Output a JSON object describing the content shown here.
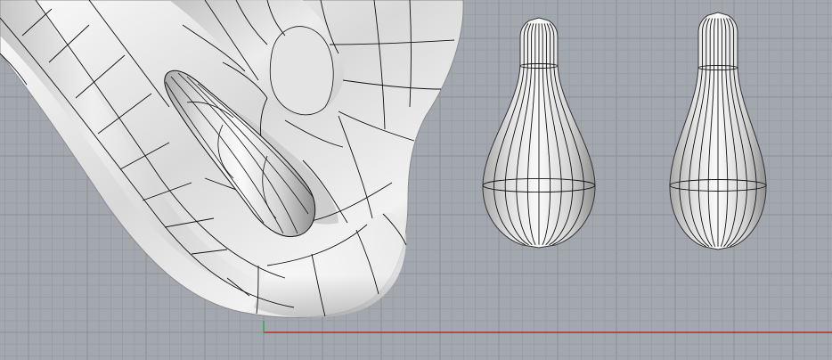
{
  "viewport": {
    "background": "#a3a7ae",
    "grid_minor_color": "#979ba3",
    "grid_major_color": "#8b8f97",
    "x_axis_color": "#c0262a",
    "y_axis_color": "#2aa84a"
  },
  "model": {
    "surface_light": "#f4f4f4",
    "surface_mid": "#d4d4d4",
    "surface_dark": "#9c9c9c",
    "isocurve_color": "#111111"
  }
}
